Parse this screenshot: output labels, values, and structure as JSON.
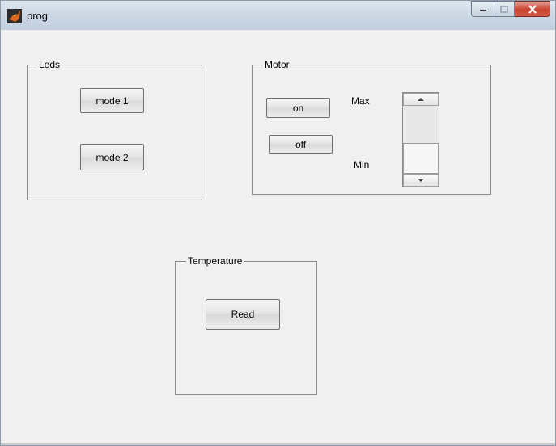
{
  "window": {
    "title": "prog"
  },
  "panels": {
    "leds": {
      "title": "Leds",
      "buttons": [
        "mode 1",
        "mode 2"
      ]
    },
    "motor": {
      "title": "Motor",
      "on_label": "on",
      "off_label": "off",
      "max_label": "Max",
      "min_label": "Min",
      "slider_level": 0.0
    },
    "temperature": {
      "title": "Temperature",
      "read_label": "Read"
    }
  },
  "colors": {
    "window_bg": "#f0f0f0",
    "close_button": "#c8442f",
    "app_icon": "#d9641c"
  }
}
